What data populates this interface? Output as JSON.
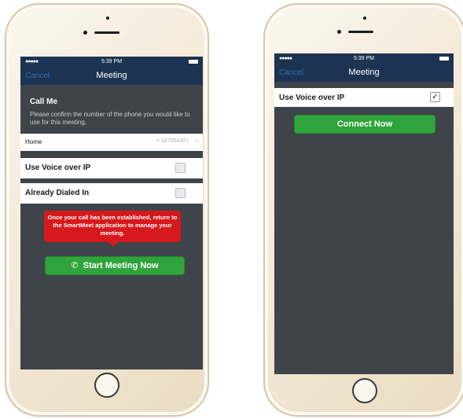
{
  "left_screen": {
    "status": {
      "signal": "●●●●●",
      "time": "5:39 PM"
    },
    "nav": {
      "cancel": "Cancel",
      "title": "Meeting"
    },
    "call_me": {
      "heading": "Call Me",
      "description": "Please confirm the number of the phone you would like to use for this meeting."
    },
    "phone_row": {
      "label": "Home",
      "value": "+ 187654321",
      "chevron": "›"
    },
    "voip_row": {
      "label": "Use Voice over IP",
      "checked": false
    },
    "dialed_row": {
      "label": "Already Dialed In",
      "checked": false
    },
    "tooltip": "Once your call has been established, return to the SmartMeet application to manage your meeting.",
    "start_button": {
      "label": "Start Meeting Now",
      "icon": "phone-icon"
    }
  },
  "right_screen": {
    "status": {
      "signal": "●●●●●",
      "time": "5:39 PM"
    },
    "nav": {
      "cancel": "Cancel",
      "title": "Meeting"
    },
    "voip_row": {
      "label": "Use Voice over IP",
      "checked": true,
      "check_mark": "✓"
    },
    "connect_button": {
      "label": "Connect Now"
    }
  },
  "colors": {
    "navbar": "#1d3352",
    "screen_bg": "#3e444a",
    "accent_green": "#2fa43a",
    "tooltip_red": "#d6191d",
    "link_blue": "#2f6fb7"
  }
}
